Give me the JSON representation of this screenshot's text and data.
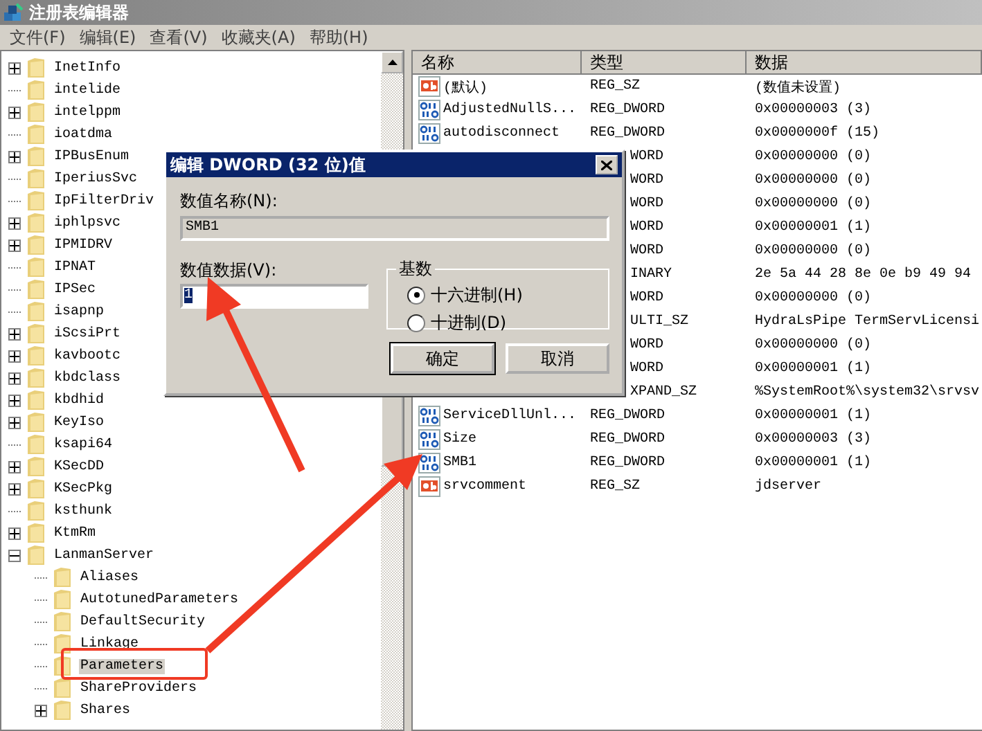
{
  "window": {
    "title": "注册表编辑器"
  },
  "menu": [
    "文件(F)",
    "编辑(E)",
    "查看(V)",
    "收藏夹(A)",
    "帮助(H)"
  ],
  "tree": [
    {
      "name": "InetInfo",
      "kind": "node",
      "expanded": false,
      "selected": false
    },
    {
      "name": "intelide",
      "kind": "leaf",
      "selected": false
    },
    {
      "name": "intelppm",
      "kind": "node",
      "expanded": false,
      "selected": false
    },
    {
      "name": "ioatdma",
      "kind": "leaf",
      "selected": false
    },
    {
      "name": "IPBusEnum",
      "kind": "node",
      "expanded": false,
      "selected": false
    },
    {
      "name": "IperiusSvc",
      "kind": "leaf",
      "selected": false
    },
    {
      "name": "IpFilterDriv",
      "kind": "leaf",
      "selected": false
    },
    {
      "name": "iphlpsvc",
      "kind": "node",
      "expanded": false,
      "selected": false
    },
    {
      "name": "IPMIDRV",
      "kind": "node",
      "expanded": false,
      "selected": false
    },
    {
      "name": "IPNAT",
      "kind": "leaf",
      "selected": false
    },
    {
      "name": "IPSec",
      "kind": "leaf",
      "selected": false
    },
    {
      "name": "isapnp",
      "kind": "leaf",
      "selected": false
    },
    {
      "name": "iScsiPrt",
      "kind": "node",
      "expanded": false,
      "selected": false
    },
    {
      "name": "kavbootc",
      "kind": "node",
      "expanded": false,
      "selected": false
    },
    {
      "name": "kbdclass",
      "kind": "node",
      "expanded": false,
      "selected": false
    },
    {
      "name": "kbdhid",
      "kind": "node",
      "expanded": false,
      "selected": false
    },
    {
      "name": "KeyIso",
      "kind": "node",
      "expanded": false,
      "selected": false
    },
    {
      "name": "ksapi64",
      "kind": "leaf",
      "selected": false
    },
    {
      "name": "KSecDD",
      "kind": "node",
      "expanded": false,
      "selected": false
    },
    {
      "name": "KSecPkg",
      "kind": "node",
      "expanded": false,
      "selected": false
    },
    {
      "name": "ksthunk",
      "kind": "leaf",
      "selected": false
    },
    {
      "name": "KtmRm",
      "kind": "node",
      "expanded": false,
      "selected": false
    },
    {
      "name": "LanmanServer",
      "kind": "node",
      "expanded": true,
      "selected": false,
      "children": [
        {
          "name": "Aliases",
          "kind": "leaf",
          "selected": false
        },
        {
          "name": "AutotunedParameters",
          "kind": "leaf",
          "selected": false
        },
        {
          "name": "DefaultSecurity",
          "kind": "leaf",
          "selected": false
        },
        {
          "name": "Linkage",
          "kind": "leaf",
          "selected": false
        },
        {
          "name": "Parameters",
          "kind": "leaf",
          "selected": true
        },
        {
          "name": "ShareProviders",
          "kind": "leaf",
          "selected": false
        },
        {
          "name": "Shares",
          "kind": "node",
          "expanded": false,
          "selected": false
        }
      ]
    }
  ],
  "columns": [
    "名称",
    "类型",
    "数据"
  ],
  "values": [
    {
      "kind": "sz",
      "name": "(默认)",
      "type": "REG_SZ",
      "data": "(数值未设置)"
    },
    {
      "kind": "dword",
      "name": "AdjustedNullS...",
      "type": "REG_DWORD",
      "data": "0x00000003 (3)"
    },
    {
      "kind": "dword",
      "name": "autodisconnect",
      "type": "REG_DWORD",
      "data": "0x0000000f (15)"
    },
    {
      "type": "WORD",
      "data": "0x00000000 (0)"
    },
    {
      "type": "WORD",
      "data": "0x00000000 (0)"
    },
    {
      "type": "WORD",
      "data": "0x00000000 (0)"
    },
    {
      "type": "WORD",
      "data": "0x00000001 (1)"
    },
    {
      "type": "WORD",
      "data": "0x00000000 (0)"
    },
    {
      "type": "INARY",
      "data": "2e 5a 44 28 8e 0e b9 49 94"
    },
    {
      "type": "WORD",
      "data": "0x00000000 (0)"
    },
    {
      "type": "ULTI_SZ",
      "data": "HydraLsPipe TermServLicensi"
    },
    {
      "type": "WORD",
      "data": "0x00000000 (0)"
    },
    {
      "type": "WORD",
      "data": "0x00000001 (1)"
    },
    {
      "type": "XPAND_SZ",
      "data": "%SystemRoot%\\system32\\srvsv"
    },
    {
      "kind": "dword",
      "name": "ServiceDllUnl...",
      "type": "REG_DWORD",
      "data": "0x00000001 (1)"
    },
    {
      "kind": "dword",
      "name": "Size",
      "type": "REG_DWORD",
      "data": "0x00000003 (3)"
    },
    {
      "kind": "dword",
      "name": "SMB1",
      "type": "REG_DWORD",
      "data": "0x00000001 (1)"
    },
    {
      "kind": "sz",
      "name": "srvcomment",
      "type": "REG_SZ",
      "data": "jdserver"
    }
  ],
  "dialog": {
    "title": "编辑 DWORD (32 位)值",
    "name_label": "数值名称(N):",
    "name_value": "SMB1",
    "data_label": "数值数据(V):",
    "data_value": "1",
    "value_selected": true,
    "base_label": "基数",
    "bases": [
      {
        "label": "十六进制(H)",
        "selected": true
      },
      {
        "label": "十进制(D)",
        "selected": false
      }
    ],
    "buttons": [
      {
        "label": "确定",
        "default": true
      },
      {
        "label": "取消",
        "default": false
      }
    ]
  }
}
